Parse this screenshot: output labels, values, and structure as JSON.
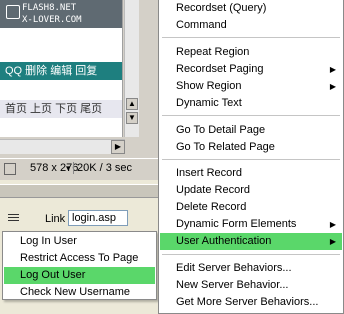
{
  "editor": {
    "logo_line1": "FLASH8.NET",
    "logo_line2": "X-LOVER.COM",
    "nav_text": "QQ 删除  编辑  回复",
    "page_text": "首页  上页  下页  尾页",
    "status_size": "578 x 276",
    "status_speed": "20K / 3 sec"
  },
  "properties": {
    "link_label": "Link",
    "link_value": "login.asp"
  },
  "context_menu": {
    "items": [
      {
        "label": "Recordset (Query)"
      },
      {
        "label": "Command"
      },
      {
        "label": "Repeat Region"
      },
      {
        "label": "Recordset Paging"
      },
      {
        "label": "Show Region"
      },
      {
        "label": "Dynamic Text"
      },
      {
        "label": "Go To Detail Page"
      },
      {
        "label": "Go To Related Page"
      },
      {
        "label": "Insert Record"
      },
      {
        "label": "Update Record"
      },
      {
        "label": "Delete Record"
      },
      {
        "label": "Dynamic Form Elements"
      },
      {
        "label": "User Authentication"
      },
      {
        "label": "Edit Server Behaviors..."
      },
      {
        "label": "New Server Behavior..."
      },
      {
        "label": "Get More Server Behaviors..."
      }
    ]
  },
  "submenu": {
    "items": [
      {
        "label": "Log In User"
      },
      {
        "label": "Restrict Access To Page"
      },
      {
        "label": "Log Out User"
      },
      {
        "label": "Check New Username"
      }
    ]
  },
  "colors": {
    "highlight": "#5ad76a",
    "nav_bar": "#1e7f7f"
  }
}
